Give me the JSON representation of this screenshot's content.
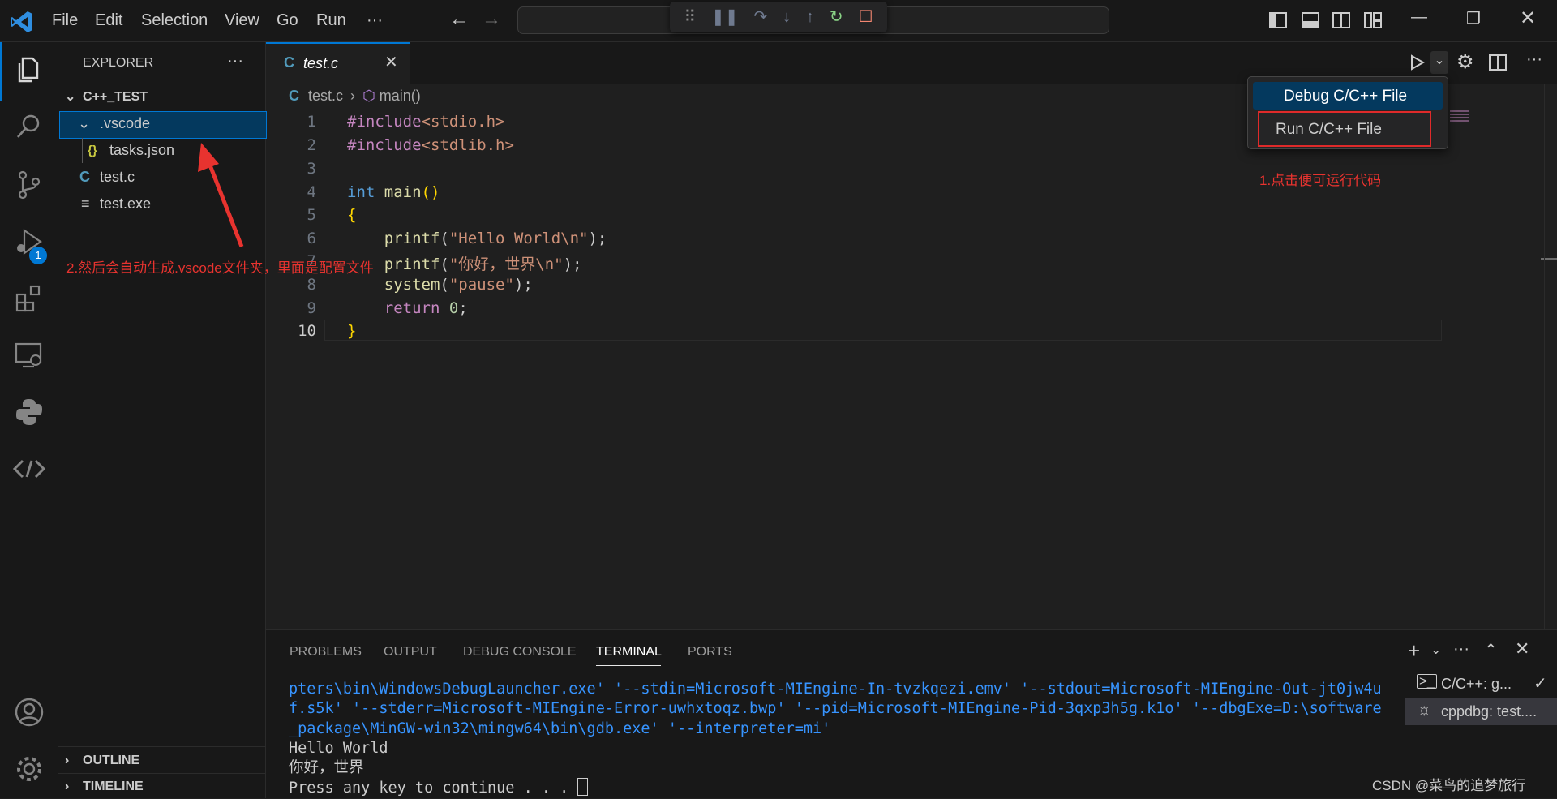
{
  "menu": [
    "File",
    "Edit",
    "Selection",
    "View",
    "Go",
    "Run",
    "···"
  ],
  "sidebar": {
    "title": "EXPLORER",
    "more": "···",
    "folder": "C++_TEST",
    "items": [
      {
        "label": ".vscode",
        "icon": "⌄"
      },
      {
        "label": "tasks.json",
        "icon": "{}"
      },
      {
        "label": "test.c",
        "icon": "C"
      },
      {
        "label": "test.exe",
        "icon": "≡"
      }
    ],
    "outline": "OUTLINE",
    "timeline": "TIMELINE"
  },
  "activity": {
    "debug_badge": "1"
  },
  "editor": {
    "tab_label": "test.c",
    "tab_icon": "C",
    "breadcrumb_file": "test.c",
    "breadcrumb_symbol": "main()",
    "line_numbers": [
      "1",
      "2",
      "3",
      "4",
      "5",
      "6",
      "7",
      "8",
      "9",
      "10"
    ],
    "lines": [
      "#include<stdio.h>",
      "#include<stdlib.h>",
      "",
      "int main()",
      "{",
      "    printf(\"Hello World\\n\");",
      "    printf(\"你好，世界\\n\");",
      "    system(\"pause\");",
      "    return 0;",
      "}"
    ]
  },
  "run_menu": {
    "debug": "Debug C/C++ File",
    "run": "Run C/C++ File"
  },
  "annotations": {
    "run_note": "1.点击便可运行代码",
    "vscode_note": "2.然后会自动生成.vscode文件夹，里面是配置文件"
  },
  "panel": {
    "tabs": [
      "PROBLEMS",
      "OUTPUT",
      "DEBUG CONSOLE",
      "TERMINAL",
      "PORTS"
    ],
    "active_tab": "TERMINAL",
    "terminal_lines": [
      "pters\\bin\\WindowsDebugLauncher.exe' '--stdin=Microsoft-MIEngine-In-tvzkqezi.emv' '--stdout=Microsoft-MIEngine-Out-jt0jw4uf.s5k' '--stderr=Microsoft-MIEngine-Error-uwhxtoqz.bwp' '--pid=Microsoft-MIEngine-Pid-3qxp3h5g.k1o' '--dbgExe=D:\\software_package\\MinGW-win32\\mingw64\\bin\\gdb.exe' '--interpreter=mi'",
      "Hello World",
      "你好，世界",
      "Press any key to continue . . . "
    ],
    "terminals": [
      "C/C++: g...",
      "cppdbg: test...."
    ]
  },
  "watermark": "CSDN @菜鸟的追梦旅行"
}
